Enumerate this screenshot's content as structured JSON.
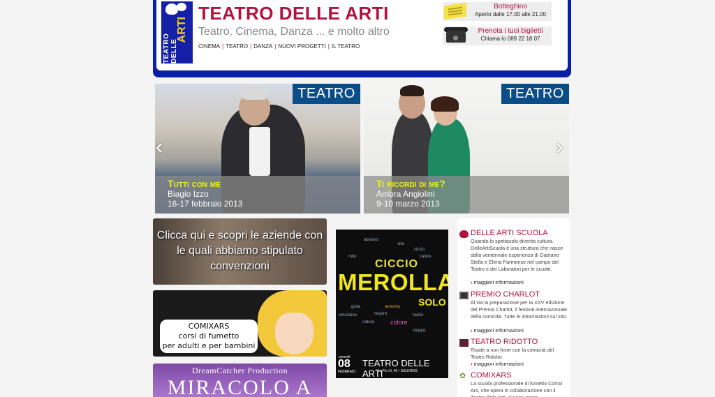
{
  "header": {
    "logo_text_1": "TEATRO DELLE",
    "logo_text_2": "ARTI",
    "title": "TEATRO DELLE ARTI",
    "subtitle": "Teatro, Cinema, Danza ... e molto altro",
    "nav": [
      "CINEMA",
      "TEATRO",
      "DANZA",
      "NUOVI PROGETTI",
      "IL TEATRO"
    ],
    "box_office": {
      "title": "Botteghino",
      "text": "Aperto dalle 17.00 alle 21.00",
      "icon": "ticket-icon"
    },
    "booking": {
      "title": "Prenota i tuoi biglietti",
      "text": "Chiama lo 089 22 18 07",
      "icon": "phone-icon"
    }
  },
  "slider": {
    "prev_icon": "chevron-left-icon",
    "next_icon": "chevron-right-icon",
    "slides": [
      {
        "category": "TEATRO",
        "title": "Tutti con me",
        "performer": "Biagio Izzo",
        "dates": "16-17 febbraio 2013"
      },
      {
        "category": "TEATRO",
        "title": "Ti ricordi di me?",
        "performer": "Ambra Angiolini",
        "dates": "9-10 marzo 2013"
      }
    ]
  },
  "promos": {
    "conventions": "Clicca qui e scopri le  aziende con le quali abbiamo stipulato convenzioni",
    "comix_line1": "COMIXARS",
    "comix_line2": "corsi di fumetto",
    "comix_line3": "per adulti e per bambini",
    "dream_production": "DreamCatcher Production",
    "dream_title": "MIRACOLO A"
  },
  "poster": {
    "words": [
      "abusivo",
      "vita",
      "ciccio",
      "calore",
      "mito",
      "emozione",
      "gioia",
      "respiro",
      "natura",
      "colore",
      "armonia",
      "teatro",
      "stoppa"
    ],
    "name_1": "CICCIO",
    "name_2": "MEROLLA",
    "name_3": "SOLO",
    "weekday": "venerdì",
    "day": "08",
    "month": "FEBBRAIO",
    "venue": "TEATRO DELLE ARTI",
    "address": "Via Pio XI, 45 • SALERNO"
  },
  "news": {
    "more_label": "maggiori informazioni",
    "items": [
      {
        "title": "DELLE ARTI SCUOLA",
        "icon": "masks-icon",
        "body": "Quando lo spettacolo diventa cultura. DelleArtiScuola è una struttura che nasce dalla ventennale esperienza di Gaetano Stella e Elena Parmense nel campo del Teatro e dei Laboratori per le scuole."
      },
      {
        "title": "PREMIO CHARLOT",
        "icon": "film-icon",
        "body": "Al via la preparazione per la XXV edizione del Premio Charlot, il festival internazionale della comicità. Tutte le informazioni sul sito."
      },
      {
        "title": "TEATRO RIDOTTO",
        "icon": "theatre-icon",
        "body": "Risate a non finire con la comicità del Teatro Ridotto"
      },
      {
        "title": "COMIXARS",
        "icon": "star-icon",
        "body": "La scuola professionale di fumetto Comix Ars, che opera in collaborazione con il Teatro delle Arti, si pone come"
      }
    ]
  }
}
